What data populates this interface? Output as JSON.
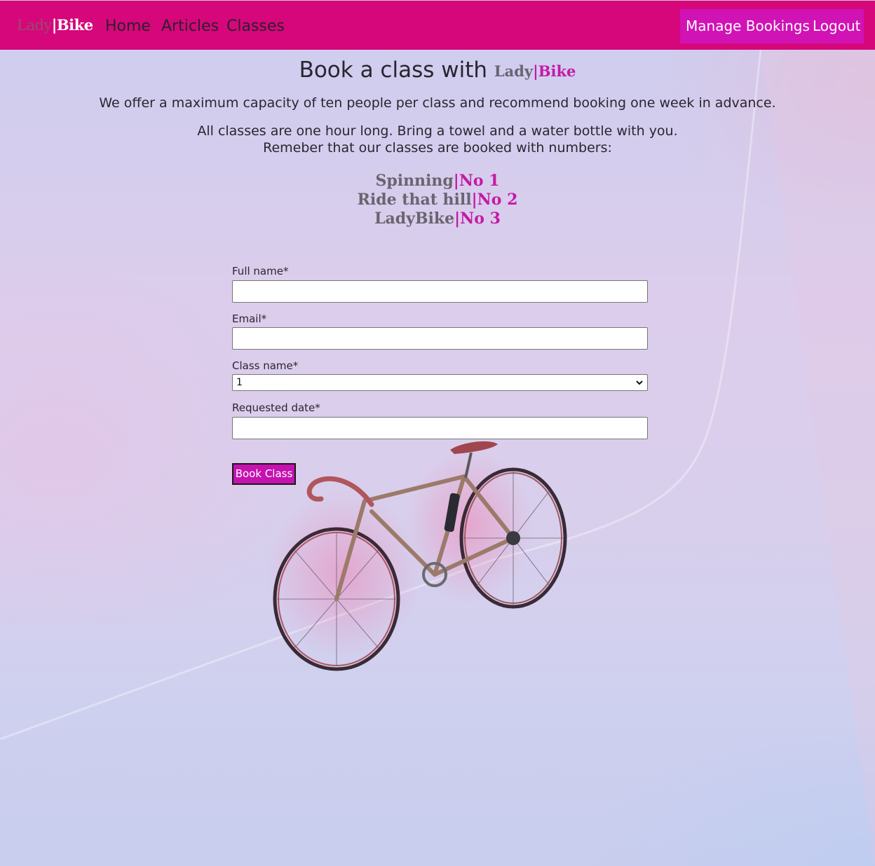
{
  "nav": {
    "brand_part1": "Lady",
    "brand_separator": "|",
    "brand_part2": "Bike",
    "links": [
      "Home",
      "Articles",
      "Classes"
    ],
    "manage_bookings": "Manage Bookings",
    "logout": "Logout"
  },
  "header": {
    "title_prefix": "Book a class with",
    "brand_part1": "Lady",
    "brand_separator": "|",
    "brand_part2": "Bike",
    "capacity_text": "We offer a maximum capacity of ten people per class and recommend booking one week in advance.",
    "duration_text": "All classes are one hour long. Bring a towel and a water bottle with you.",
    "numbers_text": "Remeber that our classes are booked with numbers:"
  },
  "classes": [
    {
      "name": "Spinning",
      "separator": "|",
      "number": "No 1"
    },
    {
      "name": "Ride that hill",
      "separator": "|",
      "number": "No 2"
    },
    {
      "name": "LadyBike",
      "separator": "|",
      "number": "No 3"
    }
  ],
  "form": {
    "full_name_label": "Full name*",
    "full_name_value": "",
    "email_label": "Email*",
    "email_value": "",
    "class_name_label": "Class name*",
    "class_name_value": "1",
    "requested_date_label": "Requested date*",
    "requested_date_value": "",
    "submit_label": "Book Class"
  },
  "colors": {
    "navbar": "#d5077a",
    "nav_right_bg": "#d112b5",
    "accent": "#c41aa6",
    "button": "#c512b0"
  },
  "icons": {
    "select_arrow": "chevron-down-icon",
    "background_image": "road-bicycle-image"
  }
}
